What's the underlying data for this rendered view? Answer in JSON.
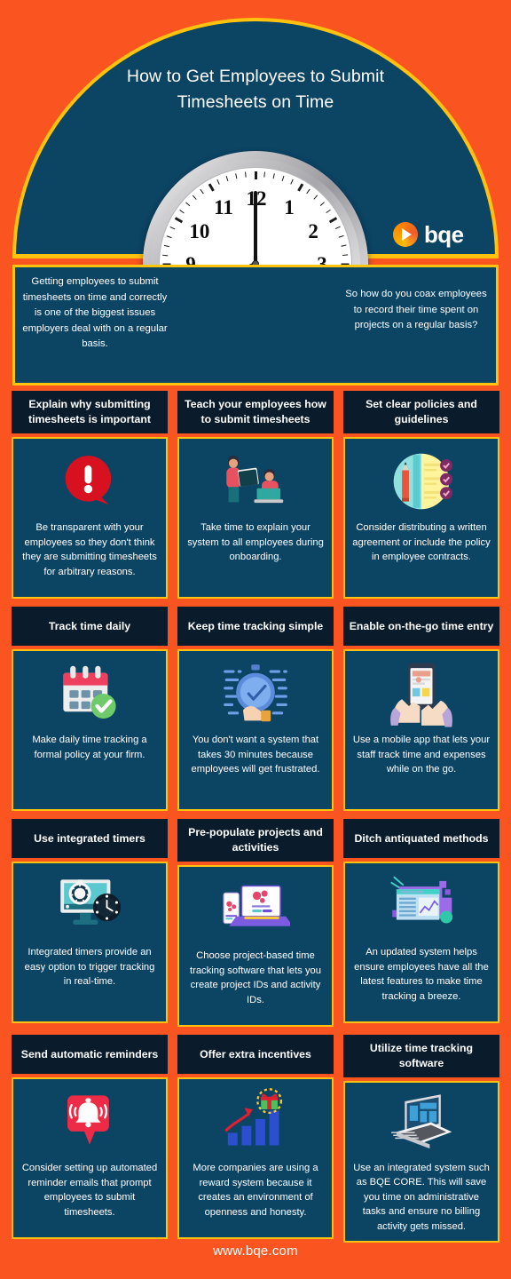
{
  "header": {
    "title": "How to Get Employees to Submit Timesheets on Time",
    "logo_text": "bqe",
    "logo_icon": "bqe-play-circle-icon",
    "clock_icon": "analog-wall-clock-icon"
  },
  "intro": {
    "left_text": "Getting employees to submit timesheets on time and correctly is one of the biggest issues employers deal with on a regular basis.",
    "right_text": "So how do you coax employees to record their time spent on projects on a regular basis?"
  },
  "cards": [
    {
      "title": "Explain why submitting timesheets is important",
      "text": "Be transparent with your employees so they don't think they are submitting timesheets for arbitrary reasons.",
      "icon": "red-exclamation-speech-bubble-icon"
    },
    {
      "title": "Teach your employees how to submit timesheets",
      "text": "Take time to explain your system to all employees during onboarding.",
      "icon": "two-people-training-laptop-icon"
    },
    {
      "title": "Set clear policies and guidelines",
      "text": "Consider distributing a written agreement or include the policy in employee contracts.",
      "icon": "checklist-pencil-document-icon"
    },
    {
      "title": "Track time daily",
      "text": "Make daily time tracking a formal policy at your firm.",
      "icon": "calendar-check-icon"
    },
    {
      "title": "Keep time tracking simple",
      "text": "You don't want a system that takes 30 minutes because employees will get frustrated.",
      "icon": "stopwatch-thumbs-up-icon"
    },
    {
      "title": "Enable on-the-go time entry",
      "text": "Use a mobile app that lets your staff track time and expenses while on the go.",
      "icon": "hands-holding-smartphone-icon"
    },
    {
      "title": "Use integrated timers",
      "text": "Integrated timers provide an easy option to trigger tracking in real-time.",
      "icon": "monitor-stopwatch-clock-icon"
    },
    {
      "title": "Pre-populate projects and activities",
      "text": "Choose project-based time tracking software that lets you create project IDs and activity IDs.",
      "icon": "laptop-phone-gears-icon"
    },
    {
      "title": "Ditch antiquated methods",
      "text": "An updated system helps ensure employees have all the latest features to make time tracking a breeze.",
      "icon": "dashboard-window-chart-icon"
    },
    {
      "title": "Send automatic reminders",
      "text": "Consider setting up automated reminder emails that prompt employees to submit timesheets.",
      "icon": "red-notification-bell-icon"
    },
    {
      "title": "Offer extra incentives",
      "text": "More companies are using a reward system because it creates an environment of openness and honesty.",
      "icon": "growth-bars-gift-icon"
    },
    {
      "title": "Utilize time tracking software",
      "text": "Use an integrated system such as BQE CORE. This will save you time on administrative tasks and ensure no billing activity gets missed.",
      "icon": "laptop-software-icon"
    }
  ],
  "footer": {
    "url": "www.bqe.com"
  },
  "colors": {
    "background_orange": "#FA5521",
    "panel_navy": "#0C4464",
    "header_navy": "#0A1B2C",
    "accent_yellow": "#FFC20E",
    "text_white": "#FFFFFF",
    "alert_red": "#D81120"
  }
}
